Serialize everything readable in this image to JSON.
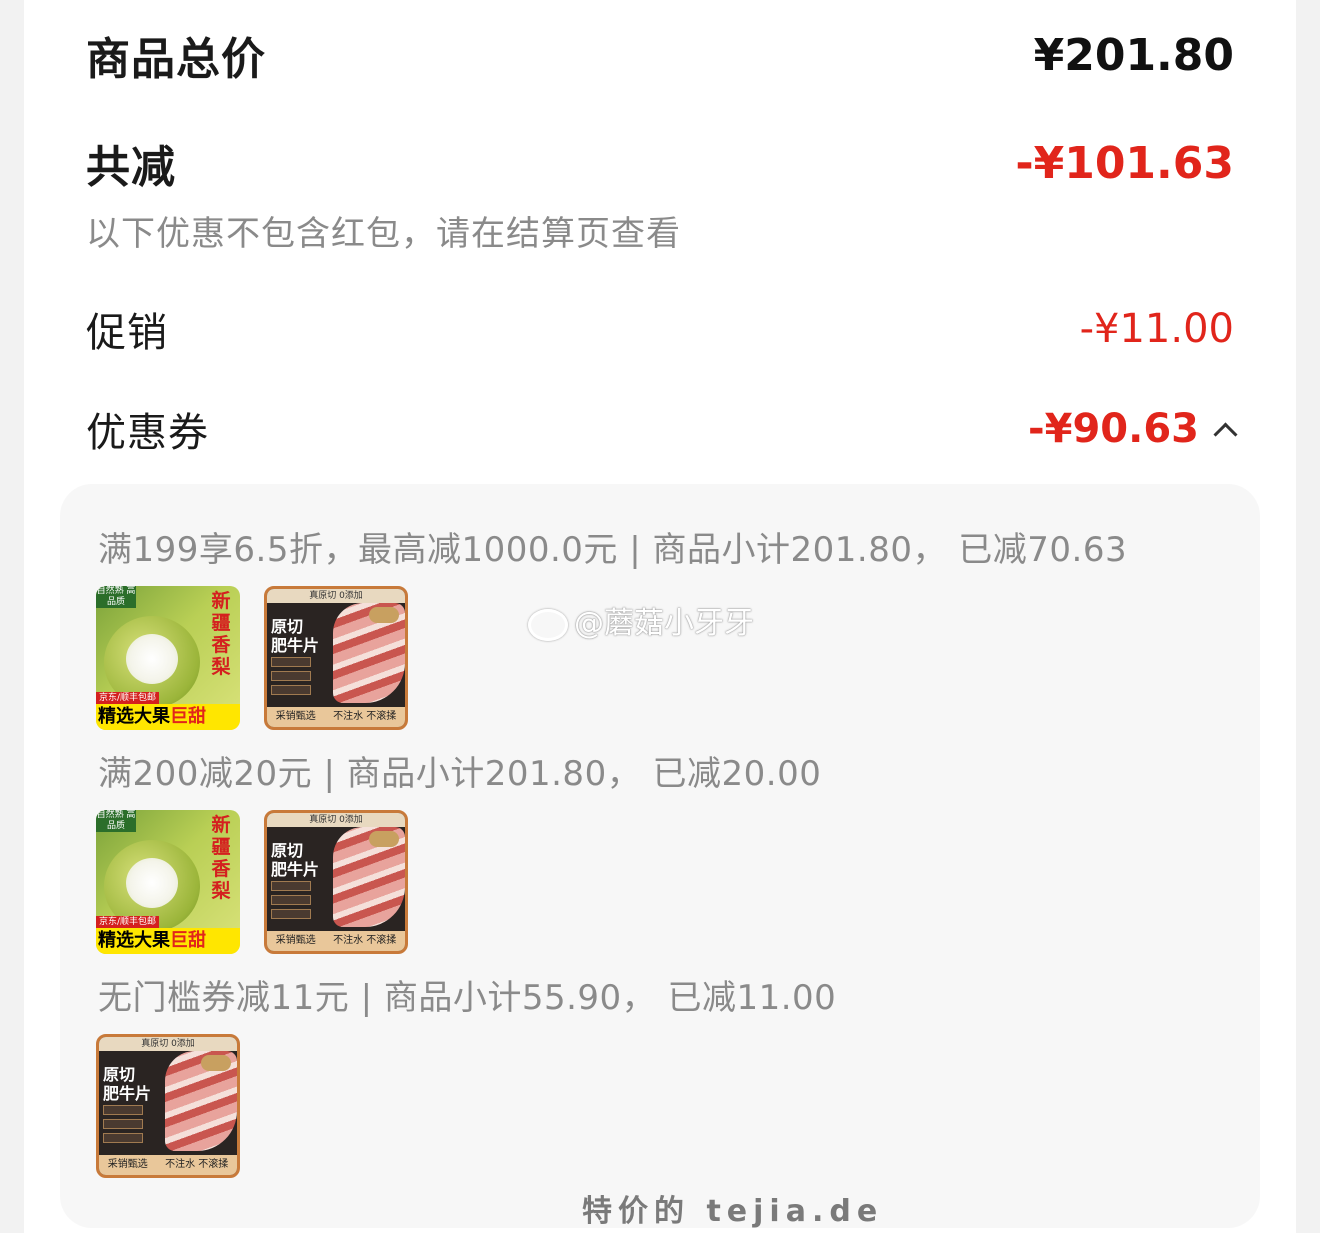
{
  "summary": {
    "total_label": "商品总价",
    "total_value": "¥201.80",
    "discount_label": "共减",
    "discount_value": "-¥101.63",
    "note": "以下优惠不包含红包，请在结算页查看",
    "promo_label": "促销",
    "promo_value": "-¥11.00",
    "coupon_label": "优惠券",
    "coupon_value": "-¥90.63",
    "coupon_icon": "chevron-up-icon"
  },
  "rules": [
    {
      "text": "满199享6.5折，最高减1000.0元 | 商品小计201.80， 已减70.63",
      "items": [
        "pear",
        "beef"
      ]
    },
    {
      "text": "满200减20元 | 商品小计201.80， 已减20.00",
      "items": [
        "pear",
        "beef"
      ]
    },
    {
      "text": "无门槛券减11元 | 商品小计55.90， 已减11.00",
      "items": [
        "beef"
      ]
    }
  ],
  "products": {
    "pear": {
      "tag": "自然熟 高品质",
      "side": "新疆香梨",
      "ship": "京东/顺丰包邮",
      "band_a": "精选大果",
      "band_b": "巨甜"
    },
    "beef": {
      "top": "真原切 0添加",
      "title_a": "原切",
      "title_b": "肥牛片",
      "bottom_a": "采销甄选",
      "bottom_b": "不注水 不滚揉"
    }
  },
  "watermark": "@蘑菇小牙牙",
  "site_mark": "特价的 tejia.de"
}
